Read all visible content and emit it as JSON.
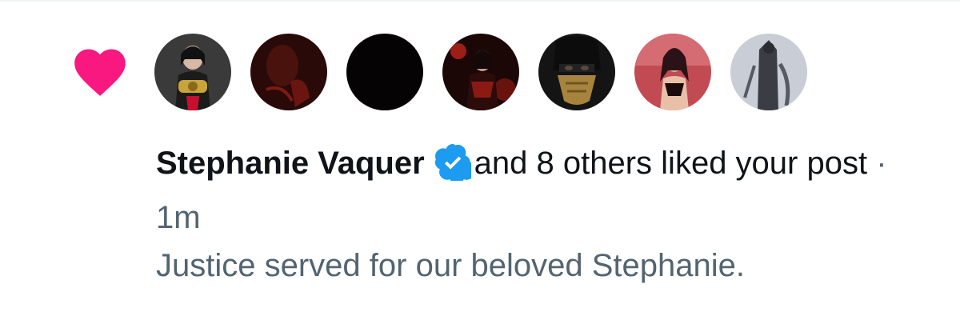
{
  "notification": {
    "type_icon": "heart-icon",
    "like_color": "#f91880",
    "avatars": [
      {
        "name": "avatar-1",
        "bg": "#3a3a3a",
        "accent": "#c8102e"
      },
      {
        "name": "avatar-2",
        "bg": "#2a0a08",
        "accent": "#6b1510"
      },
      {
        "name": "avatar-3",
        "bg": "#050304",
        "accent": "#0c0a0b"
      },
      {
        "name": "avatar-4",
        "bg": "#1a0706",
        "accent": "#d42a1f"
      },
      {
        "name": "avatar-5",
        "bg": "#141414",
        "accent": "#a6843e"
      },
      {
        "name": "avatar-6",
        "bg": "#c24a53",
        "accent": "#2b1216"
      },
      {
        "name": "avatar-7",
        "bg": "#c9cdd6",
        "accent": "#3a3d44"
      }
    ],
    "user_name": "Stephanie Vaquer",
    "verified_icon": "verified-badge-icon",
    "verified_color": "#1d9bf0",
    "action_text": "and 8 others liked your post",
    "separator": "·",
    "timestamp": "1m",
    "post_preview": "Justice served for our beloved Stephanie."
  }
}
